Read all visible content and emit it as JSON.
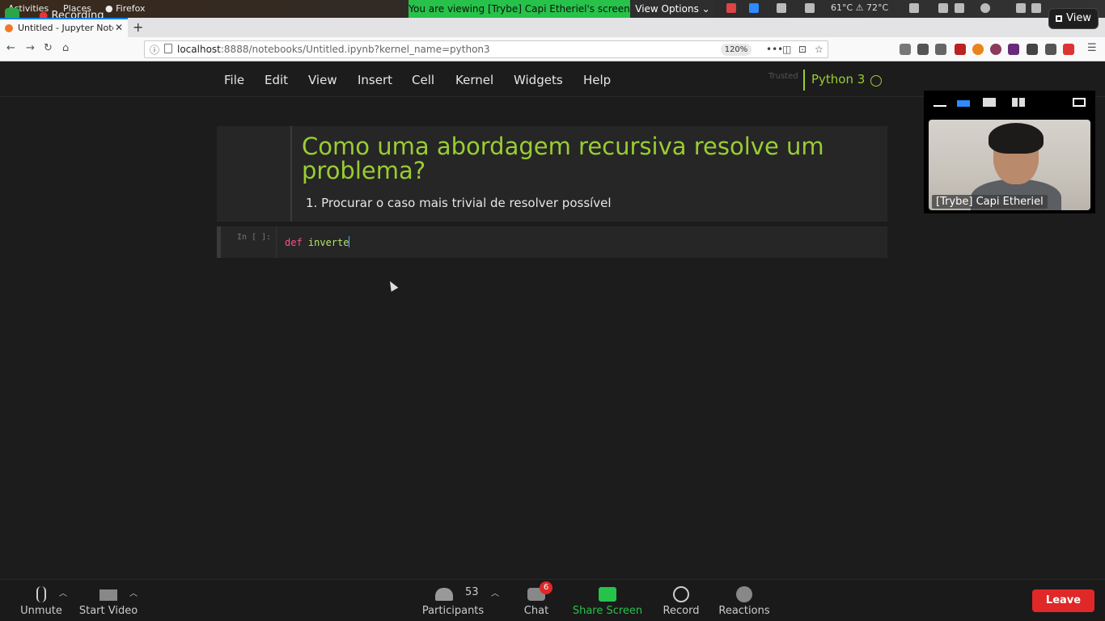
{
  "gnome": {
    "activities": "Activities",
    "places": "Places",
    "firefox": "Firefox",
    "recording": "Recording",
    "temps": "61°C  ⚠ 72°C"
  },
  "zoom_share": {
    "banner": "You are viewing [Trybe] Capi Etheriel's screen",
    "view_options": "View Options"
  },
  "browser": {
    "tab_title": "Untitled - Jupyter Note",
    "url_host": "localhost",
    "url_rest": ":8888/notebooks/Untitled.ipynb?kernel_name=python3",
    "zoom": "120%"
  },
  "jupyter": {
    "menus": [
      "File",
      "Edit",
      "View",
      "Insert",
      "Cell",
      "Kernel",
      "Widgets",
      "Help"
    ],
    "trusted": "Trusted",
    "kernel": "Python 3",
    "markdown_heading": "Como uma abordagem recursiva resolve um problema?",
    "markdown_list": [
      "Procurar o caso mais trivial de resolver possível"
    ],
    "code_prompt": "In [ ]:",
    "code_keyword": "def",
    "code_name": " inverte"
  },
  "zoom_video": {
    "participant_name": "[Trybe] Capi Etheriel",
    "view_button": "View"
  },
  "zoom_toolbar": {
    "unmute": "Unmute",
    "start_video": "Start Video",
    "participants": "Participants",
    "participant_count": "53",
    "chat": "Chat",
    "chat_badge": "6",
    "share_screen": "Share Screen",
    "record": "Record",
    "reactions": "Reactions",
    "leave": "Leave",
    "share_color": "#27c24a",
    "leave_color": "#e02828"
  }
}
